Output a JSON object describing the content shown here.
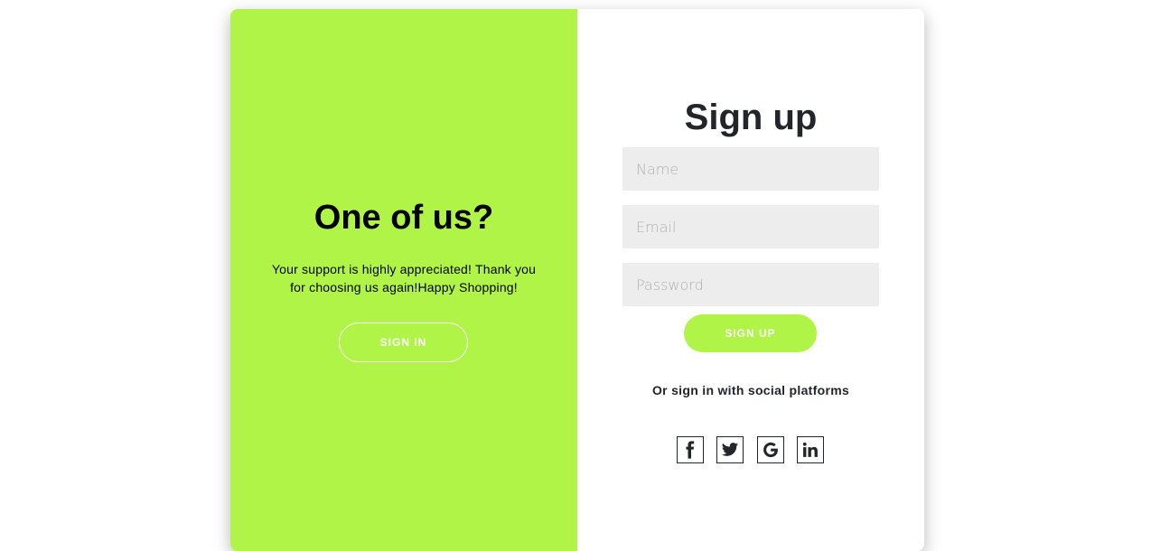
{
  "left_panel": {
    "title": "One of us?",
    "text": "Your support is highly appreciated! Thank you for choosing us again!Happy Shopping!",
    "button_label": "SIGN IN",
    "background_color": "#b1f448"
  },
  "right_panel": {
    "title": "Sign up",
    "fields": {
      "name_placeholder": "Name",
      "email_placeholder": "Email",
      "password_placeholder": "Password"
    },
    "button_label": "SIGN UP",
    "social_text": "Or sign in with social platforms",
    "social_icons": [
      "facebook-icon",
      "twitter-icon",
      "google-icon",
      "linkedin-icon"
    ]
  }
}
